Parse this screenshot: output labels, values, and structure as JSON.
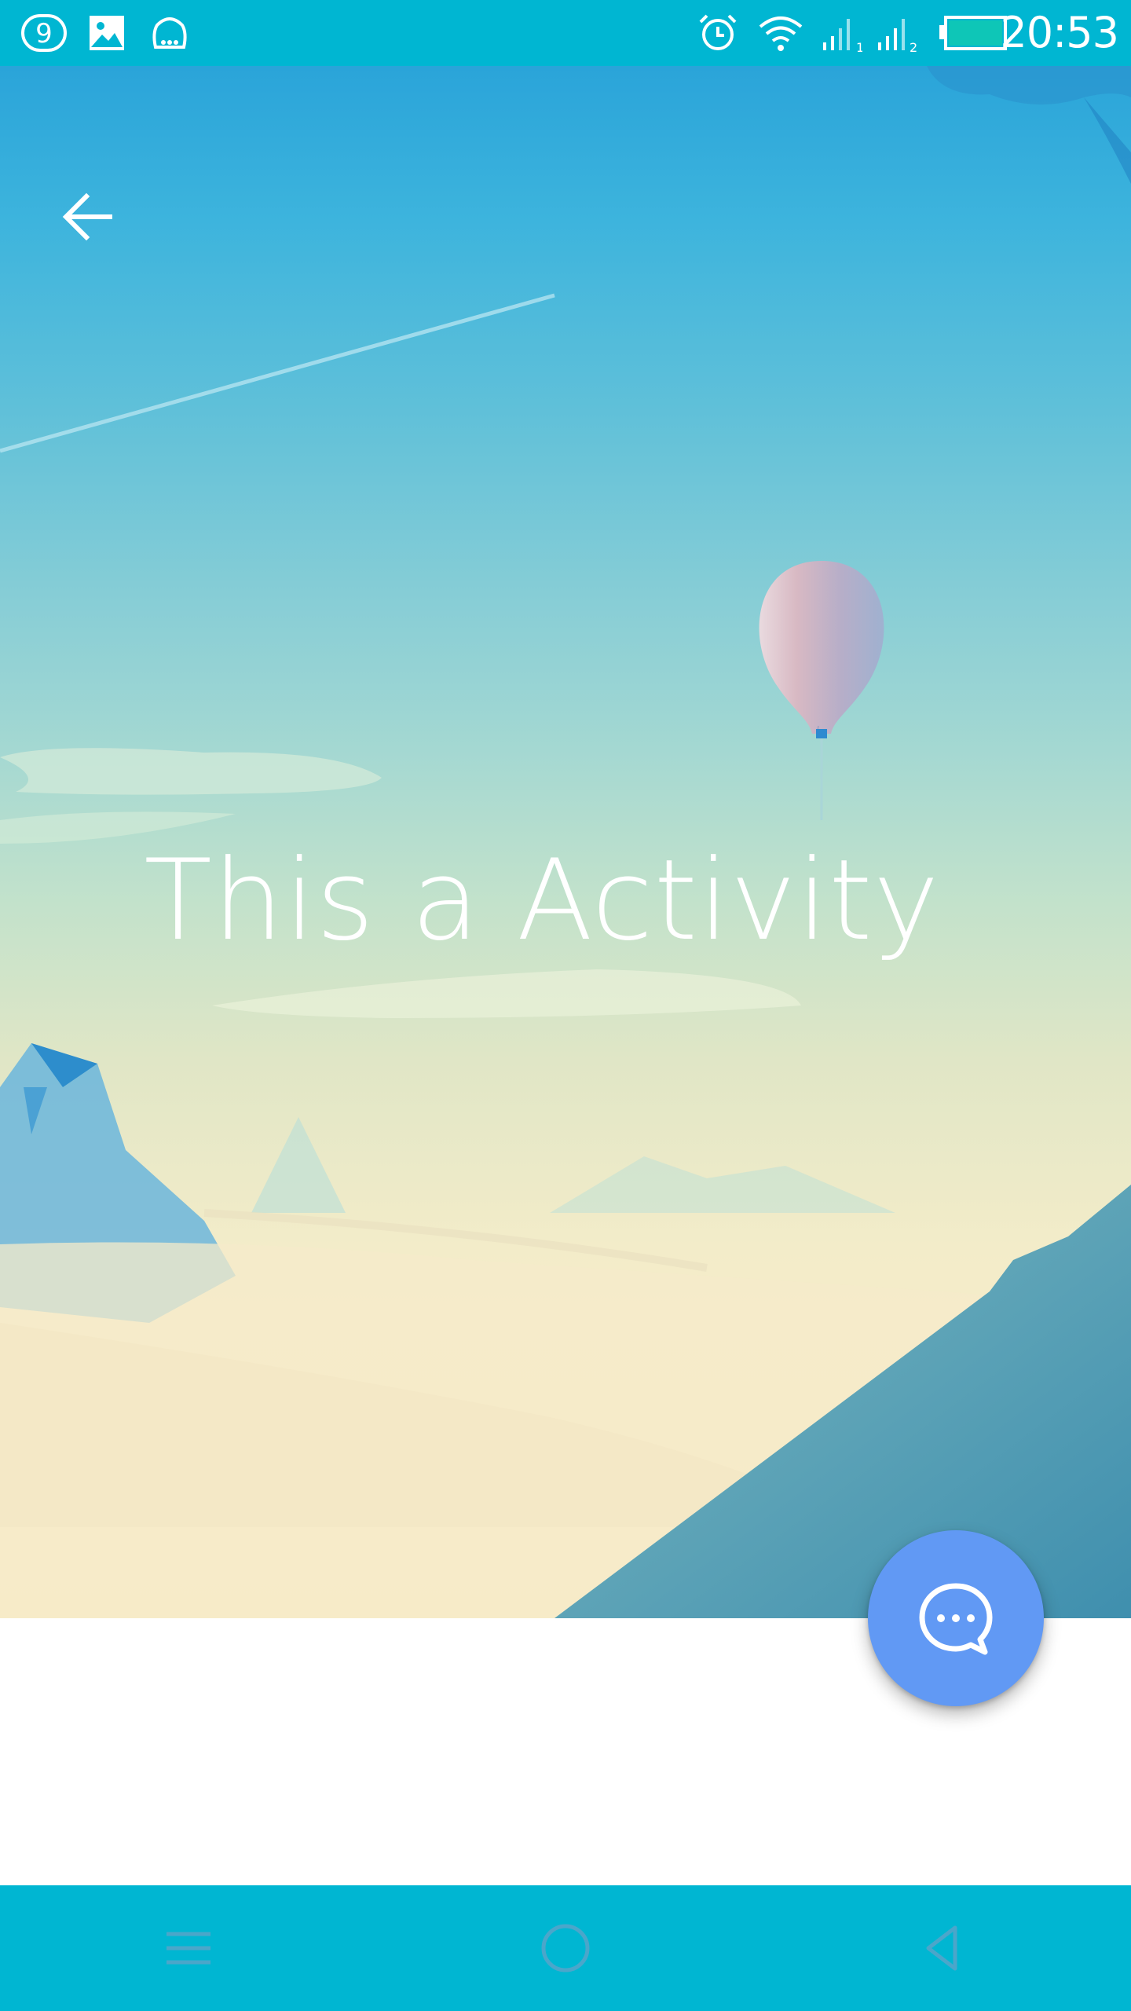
{
  "status_bar": {
    "time": "20:53",
    "icons": [
      "notification-count-icon",
      "image-icon",
      "chat-bubble-icon",
      "alarm-icon",
      "wifi-icon",
      "signal-1-icon",
      "signal-2-icon",
      "battery-icon"
    ],
    "notification_badge": "9"
  },
  "header": {
    "back_icon": "arrow-left-icon"
  },
  "hero": {
    "title": "This a Activity"
  },
  "fab": {
    "icon": "chat-bubble-icon",
    "color": "#6199f4"
  },
  "nav_bar": {
    "buttons": [
      "menu-icon",
      "home-icon",
      "back-triangle-icon"
    ]
  },
  "colors": {
    "system_bar": "#00b6d2",
    "fab": "#6199f4"
  }
}
